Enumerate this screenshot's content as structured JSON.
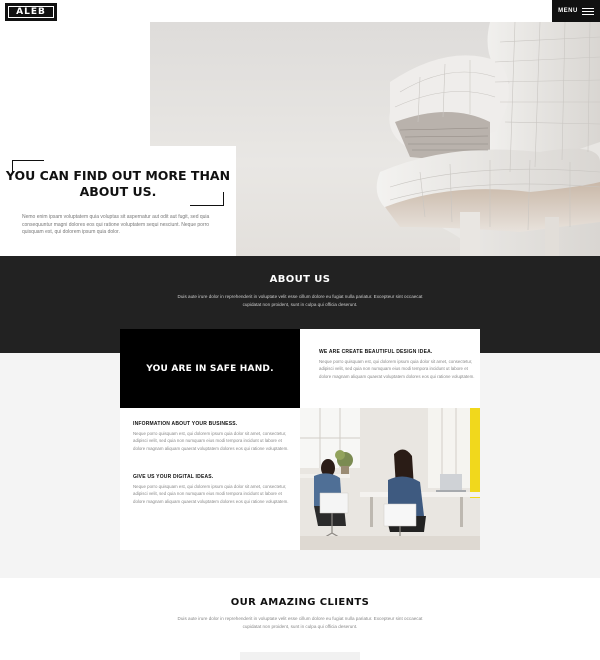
{
  "header": {
    "logo_text": "ALEB",
    "menu_label": "MENU"
  },
  "hero": {
    "title": "YOU CAN FIND OUT MORE THAN ABOUT US.",
    "text": "Nemo enim ipsam voluptatem quia voluptas sit aspernatur aut odit aut fugit, sed quia consequuntur magni dolores eos qui ratione voluptatem sequi nesciunt. Neque porro quisquam est, qui dolorem ipsum quia dolor.",
    "image": "building-photo"
  },
  "about": {
    "title": "ABOUT US",
    "text": "Duis aute irure dolor in reprehenderit in voluptate velit esse cillum dolore eu fugiat nulla pariatur. Excepteur sint occaecat cupidatat non proident, sunt in culpa qui officia deserunt."
  },
  "features": {
    "safe_hand": "YOU ARE IN SAFE HAND.",
    "blocks": [
      {
        "title": "WE ARE CREATE BEAUTIFUL DESIGN IDEA.",
        "text": "Neque porro quisquam est, qui dolorem ipsum quia dolor sit amet, consectetur, adipisci velit, sed quia non numquam eius modi tempora incidunt ut labore et dolore magnam aliquam quaerat voluptatem dolores eos qui ratione voluptatem."
      },
      {
        "title": "INFORMATION ABOUT YOUR BUSINESS.",
        "text": "Neque porro quisquam est, qui dolorem ipsum quia dolor sit amet, consectetur, adipisci velit, sed quia non numquam eius modi tempora incidunt ut labore et dolore magnam aliquam quaerat voluptatem dolores eos qui ratione voluptatem."
      },
      {
        "title": "GIVE US YOUR DIGITAL IDEAS.",
        "text": "Neque porro quisquam est, qui dolorem ipsum quia dolor sit amet, consectetur, adipisci velit, sed quia non numquam eius modi tempora incidunt ut labore et dolore magnam aliquam quaerat voluptatem dolores eos qui ratione voluptatem."
      }
    ],
    "image": "office-photo"
  },
  "clients": {
    "title": "OUR AMAZING CLIENTS",
    "text": "Duis aute irure dolor in reprehenderit in voluptate velit esse cillum dolore eu fugiat nulla pariatur. Excepteur sint occaecat cupidatat non proident, sunt in culpa qui officia deserunt."
  },
  "colors": {
    "dark": "#222222",
    "black": "#000000",
    "light_bg": "#f4f4f4"
  }
}
